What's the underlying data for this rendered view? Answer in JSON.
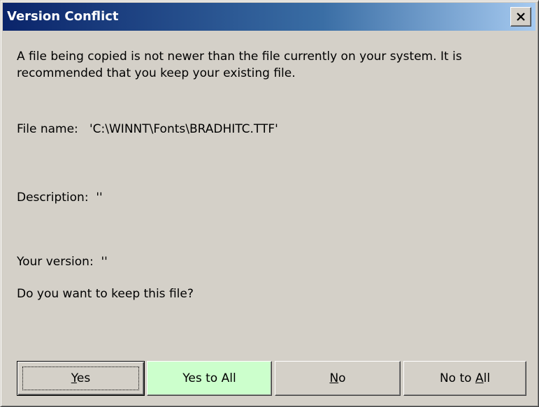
{
  "window": {
    "title": "Version Conflict",
    "close_icon": "close-icon"
  },
  "message": "A file being copied is not newer than the file currently on your system. It is recommended that you keep your existing file.",
  "file_name_line": "File name:   'C:\\WINNT\\Fonts\\BRADHITC.TTF'",
  "description_line": "Description:  ''",
  "your_version_line": "Your version:  ''",
  "question": "Do you want to keep this file?",
  "buttons": {
    "yes": {
      "pre": "",
      "acc": "Y",
      "post": "es"
    },
    "yes_to_all": {
      "label": "Yes to All",
      "highlight_color": "#ccffcc"
    },
    "no": {
      "pre": "",
      "acc": "N",
      "post": "o"
    },
    "no_to_all": {
      "pre": "No to ",
      "acc": "A",
      "post": "ll"
    }
  },
  "colors": {
    "title_gradient_start": "#0a246a",
    "title_gradient_end": "#a6caf0",
    "dialog_face": "#d4d0c8"
  }
}
